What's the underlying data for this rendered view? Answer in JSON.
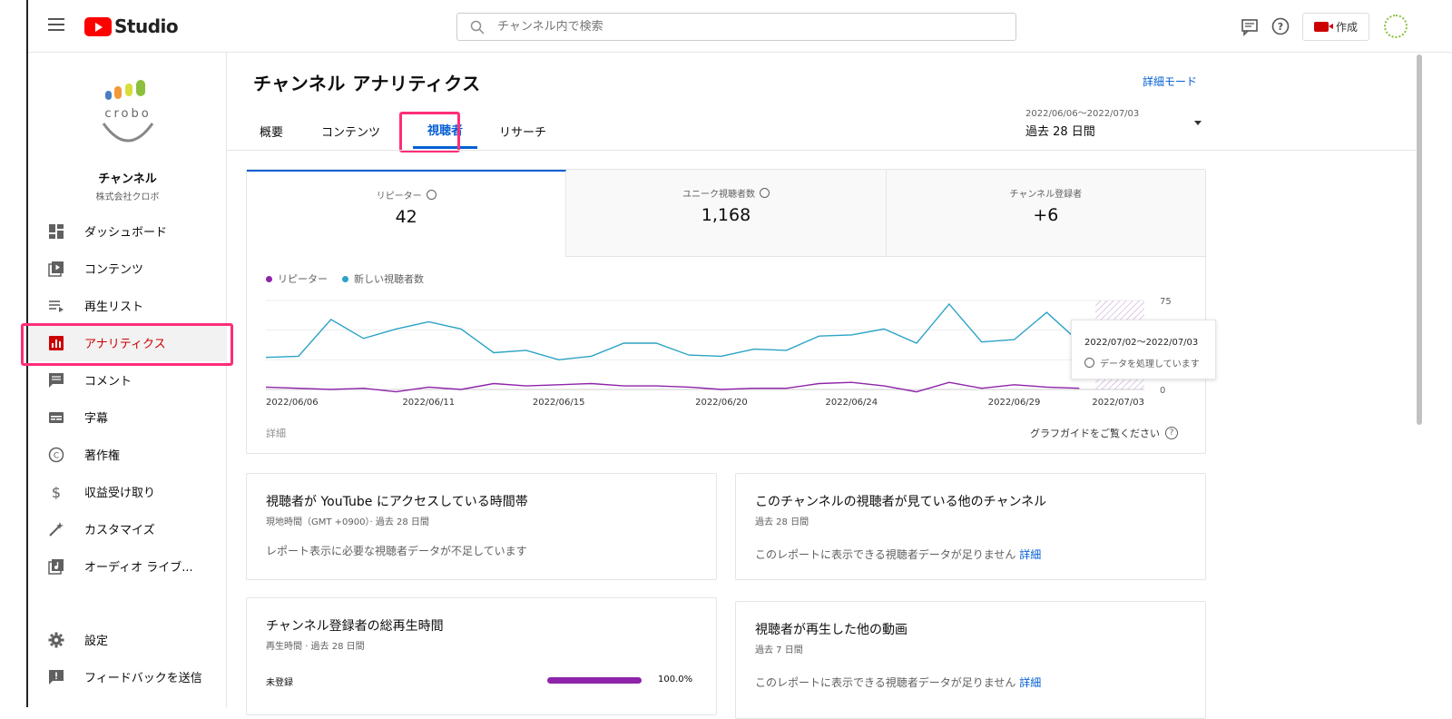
{
  "app": {
    "logo_text": "Studio"
  },
  "search": {
    "placeholder": "チャンネル内で検索"
  },
  "header": {
    "create_label": "作成"
  },
  "channel": {
    "name": "チャンネル",
    "company": "株式会社クロボ",
    "logo_text": "crobo"
  },
  "sidebar": {
    "items": [
      {
        "label": "ダッシュボード",
        "icon": "dashboard-icon"
      },
      {
        "label": "コンテンツ",
        "icon": "content-icon"
      },
      {
        "label": "再生リスト",
        "icon": "playlist-icon"
      },
      {
        "label": "アナリティクス",
        "icon": "analytics-icon",
        "active": true
      },
      {
        "label": "コメント",
        "icon": "comment-icon"
      },
      {
        "label": "字幕",
        "icon": "subtitles-icon"
      },
      {
        "label": "著作権",
        "icon": "copyright-icon"
      },
      {
        "label": "収益受け取り",
        "icon": "dollar-icon"
      },
      {
        "label": "カスタマイズ",
        "icon": "magic-wand-icon"
      },
      {
        "label": "オーディオ ライブ...",
        "icon": "audio-library-icon"
      }
    ],
    "bottom": [
      {
        "label": "設定",
        "icon": "gear-icon"
      },
      {
        "label": "フィードバックを送信",
        "icon": "feedback-icon"
      }
    ]
  },
  "main": {
    "title": "チャンネル アナリティクス",
    "detail_mode": "詳細モード",
    "tabs": [
      {
        "label": "概要"
      },
      {
        "label": "コンテンツ"
      },
      {
        "label": "視聴者",
        "active": true
      },
      {
        "label": "リサーチ"
      }
    ],
    "date": {
      "range": "2022/06/06～2022/07/03",
      "label": "過去 28 日間"
    }
  },
  "metrics": [
    {
      "label": "リピーター",
      "value": "42",
      "active": true,
      "clock": true
    },
    {
      "label": "ユニーク視聴者数",
      "value": "1,168",
      "clock": true
    },
    {
      "label": "チャンネル登録者",
      "value": "+6",
      "clock": false
    }
  ],
  "chart_data": {
    "type": "line",
    "x": [
      "2022/06/06",
      "2022/06/07",
      "2022/06/08",
      "2022/06/09",
      "2022/06/10",
      "2022/06/11",
      "2022/06/12",
      "2022/06/13",
      "2022/06/14",
      "2022/06/15",
      "2022/06/16",
      "2022/06/17",
      "2022/06/18",
      "2022/06/19",
      "2022/06/20",
      "2022/06/21",
      "2022/06/22",
      "2022/06/23",
      "2022/06/24",
      "2022/06/25",
      "2022/06/26",
      "2022/06/27",
      "2022/06/28",
      "2022/06/29",
      "2022/06/30",
      "2022/07/01",
      "2022/07/02",
      "2022/07/03"
    ],
    "tick_labels": [
      "2022/06/06",
      "2022/06/11",
      "2022/06/15",
      "2022/06/20",
      "2022/06/24",
      "2022/06/29",
      "2022/07/03"
    ],
    "series": [
      {
        "name": "新しい視聴者数",
        "color": "#2ba3c6",
        "values": [
          27,
          28,
          59,
          43,
          51,
          57,
          51,
          31,
          33,
          25,
          28,
          39,
          39,
          29,
          28,
          34,
          33,
          45,
          46,
          51,
          39,
          72,
          40,
          42,
          65,
          40,
          null,
          null
        ]
      },
      {
        "name": "リピーター",
        "color": "#8e24aa",
        "values": [
          2,
          1,
          0,
          1,
          -2,
          2,
          0,
          5,
          3,
          4,
          5,
          3,
          3,
          2,
          0,
          1,
          1,
          5,
          6,
          3,
          -2,
          6,
          1,
          4,
          2,
          1,
          null,
          null
        ]
      }
    ],
    "ylim": [
      0,
      75
    ],
    "yticks": [
      "75",
      "0"
    ],
    "pending_range": [
      "2022/07/02",
      "2022/07/03"
    ],
    "grid": true,
    "legend": "top-left"
  },
  "chart": {
    "detail_label": "詳細",
    "guide_label": "グラフガイドをご覧ください"
  },
  "tooltip": {
    "date": "2022/07/02～2022/07/03",
    "status": "データを処理しています"
  },
  "reports": {
    "access_time": {
      "title": "視聴者が YouTube にアクセスしている時間帯",
      "sub": "現地時間（GMT +0900）· 過去 28 日間",
      "msg": "レポート表示に必要な視聴者データが不足しています"
    },
    "other_channels": {
      "title": "このチャンネルの視聴者が見ている他のチャンネル",
      "sub": "過去 28 日間",
      "msg": "このレポートに表示できる視聴者データが足りません",
      "link": "詳細"
    },
    "subscriber_watch": {
      "title": "チャンネル登録者の総再生時間",
      "sub": "再生時間 · 過去 28 日間",
      "row_label": "未登録",
      "row_value": "100.0%",
      "row_fraction": 1.0
    },
    "other_videos": {
      "title": "視聴者が再生した他の動画",
      "sub": "過去 7 日間",
      "msg": "このレポートに表示できる視聴者データが足りません",
      "link": "詳細"
    }
  }
}
